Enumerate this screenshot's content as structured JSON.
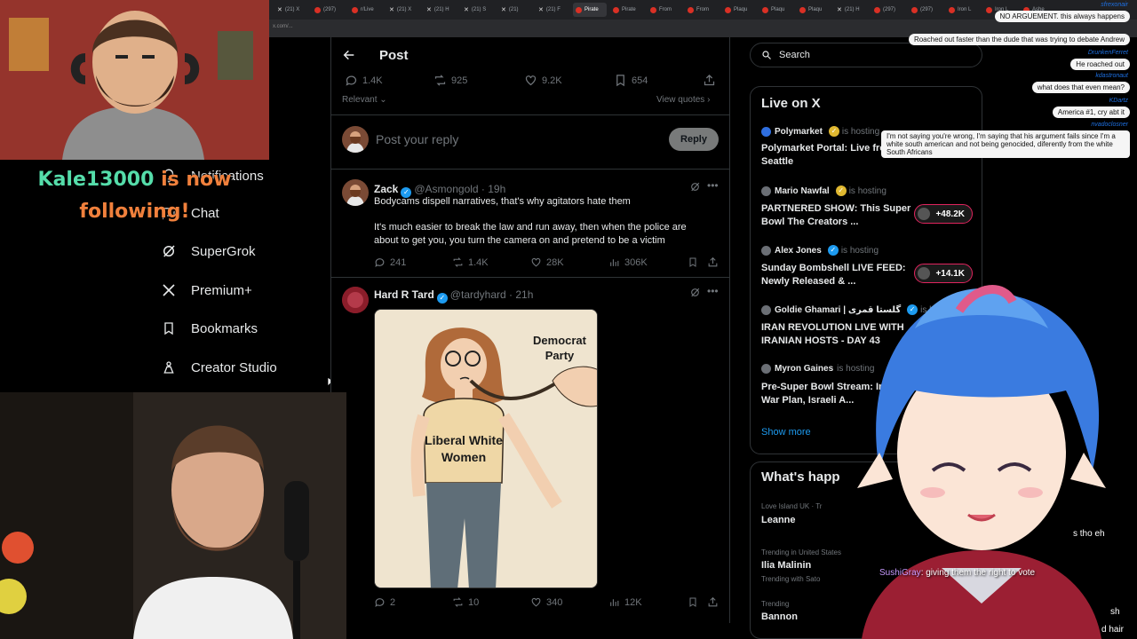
{
  "browser": {
    "tabs": [
      "(21) X",
      "(297)",
      "r/Live",
      "(21) X",
      "(21) H",
      "(21) S",
      "(21)",
      "(21) F",
      "Pirate",
      "Pirate",
      "From",
      "From",
      "Plaqu",
      "Plaqu",
      "Plaqu",
      "(21) H",
      "(297)",
      "(297)",
      "Iron L",
      "Iron L",
      "Ashe"
    ],
    "active_tab_index": 8,
    "url_text": "x.com/..."
  },
  "left_nav": {
    "items": [
      {
        "label": "Notifications",
        "icon": "bell-icon"
      },
      {
        "label": "Chat",
        "icon": "chat-icon"
      },
      {
        "label": "SuperGrok",
        "icon": "grok-icon"
      },
      {
        "label": "Premium+",
        "icon": "x-logo-icon"
      },
      {
        "label": "Bookmarks",
        "icon": "bookmark-icon"
      },
      {
        "label": "Creator Studio",
        "icon": "creator-studio-icon"
      }
    ]
  },
  "follow_alert": {
    "name": "Kale13000",
    "rest_line1": " is now",
    "line2": "following!"
  },
  "post": {
    "header_title": "Post",
    "stats": {
      "replies": "1.4K",
      "reposts": "925",
      "likes": "9.2K",
      "bookmarks": "654"
    },
    "sort_label": "Relevant",
    "view_quotes": "View quotes",
    "reply_placeholder": "Post your reply",
    "reply_button": "Reply"
  },
  "tweets": [
    {
      "name": "Zack",
      "handle": "@Asmongold",
      "time": "19h",
      "text1": "Bodycams dispell narratives, that's why agitators hate them",
      "text2": "It's much easier to break the law and run away, then when the police are about to get you, you turn the camera on and pretend to be a victim",
      "replies": "241",
      "reposts": "1.4K",
      "likes": "28K",
      "views": "306K"
    },
    {
      "name": "Hard R Tard",
      "handle": "@tardyhard",
      "time": "21h",
      "image_text_party": "Democrat Party",
      "image_text_shirt": "Liberal White Women",
      "replies": "2",
      "reposts": "10",
      "likes": "340",
      "views": "12K"
    }
  ],
  "right_sidebar": {
    "search_placeholder": "Search",
    "live_title": "Live on X",
    "hosting_label": "is hosting",
    "live_items": [
      {
        "host": "Polymarket",
        "title": "Polymarket Portal: Live from Boston and Seattle",
        "listeners": ""
      },
      {
        "host": "Mario Nawfal",
        "title": "PARTNERED SHOW: This Super Bowl The Creators ...",
        "listeners": "+48.2K"
      },
      {
        "host": "Alex Jones",
        "title": "Sunday Bombshell LIVE FEED: Newly Released & ...",
        "listeners": "+14.1K"
      },
      {
        "host": "Goldie Ghamari | گلستا قمری",
        "title": "IRAN REVOLUTION LIVE WITH IRANIAN HOSTS - DAY 43",
        "listeners": ""
      },
      {
        "host": "Myron Gaines",
        "title": "Pre-Super Bowl Stream: Iran War Plan, Israeli A...",
        "listeners": ""
      }
    ],
    "show_more": "Show more",
    "happening_title": "What's happ",
    "trends": [
      {
        "context": "Love Island UK · Tr",
        "name": "Leanne",
        "sub": ""
      },
      {
        "context": "Trending in United States",
        "name": "Ilia Malinin",
        "sub": "Trending with Sato"
      },
      {
        "context": "Trending",
        "name": "Bannon",
        "sub": ""
      }
    ]
  },
  "chat": [
    {
      "user": "sfrexonair",
      "text": "NO ARGUEMENT. this always happens"
    },
    {
      "user": "",
      "text": "Roached out faster than the dude that was trying to debate Andrew"
    },
    {
      "user": "DrunkenFerret",
      "text": "He roached out"
    },
    {
      "user": "kdastronaut",
      "text": "what does that even mean?"
    },
    {
      "user": "KDartz",
      "text": "America #1, cry abt it"
    },
    {
      "user": "nvadoclosner",
      "text": "I'm not saying you're wrong, I'm saying that his argument fails since I'm a white south american and not being genocided, diferently from the white South Africans"
    }
  ],
  "chat_bottom": [
    {
      "user": "",
      "text": "s tho eh"
    },
    {
      "user": "SushiGray",
      "text": "giving them the right to vote"
    },
    {
      "user": "",
      "text": "sh"
    },
    {
      "user": "",
      "text": "d hair"
    }
  ],
  "colors": {
    "accent": "#1d9bf0",
    "border": "#2f3336",
    "muted": "#71767b",
    "live_pink": "#e0245e"
  }
}
